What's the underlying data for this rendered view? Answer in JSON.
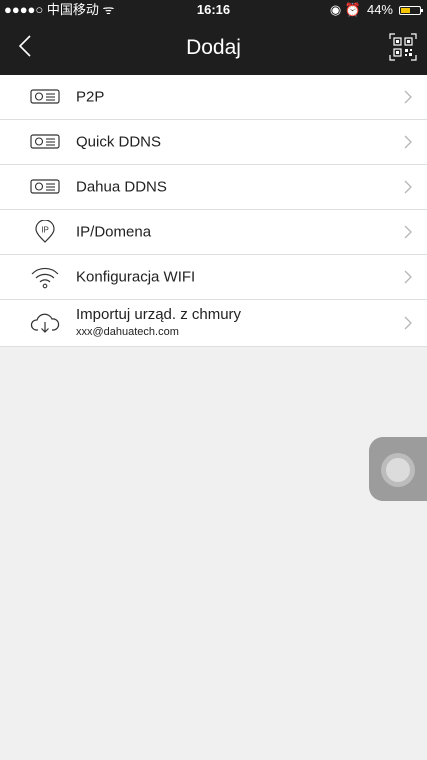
{
  "status_bar": {
    "carrier": "●●●●○ 中国移动 ᯤ",
    "time": "16:16",
    "indicators": "◉ ⏰",
    "battery_text": "44%",
    "battery_color": "#f5c400"
  },
  "nav": {
    "title": "Dodaj",
    "back_icon": "chevron-left-icon",
    "qr_icon": "qr-scan-icon"
  },
  "menu": [
    {
      "label": "P2P",
      "icon": "device-icon"
    },
    {
      "label": "Quick DDNS",
      "icon": "device-icon"
    },
    {
      "label": "Dahua DDNS",
      "icon": "device-icon"
    },
    {
      "label": "IP/Domena",
      "icon": "ip-pin-icon"
    },
    {
      "label": "Konfiguracja WIFI",
      "icon": "wifi-icon"
    },
    {
      "label": "Importuj urząd. z chmury",
      "sublabel": "xxx@dahuatech.com",
      "icon": "cloud-download-icon"
    }
  ],
  "colors": {
    "header_bg": "#1e1e1e",
    "background": "#f0f0f0"
  }
}
